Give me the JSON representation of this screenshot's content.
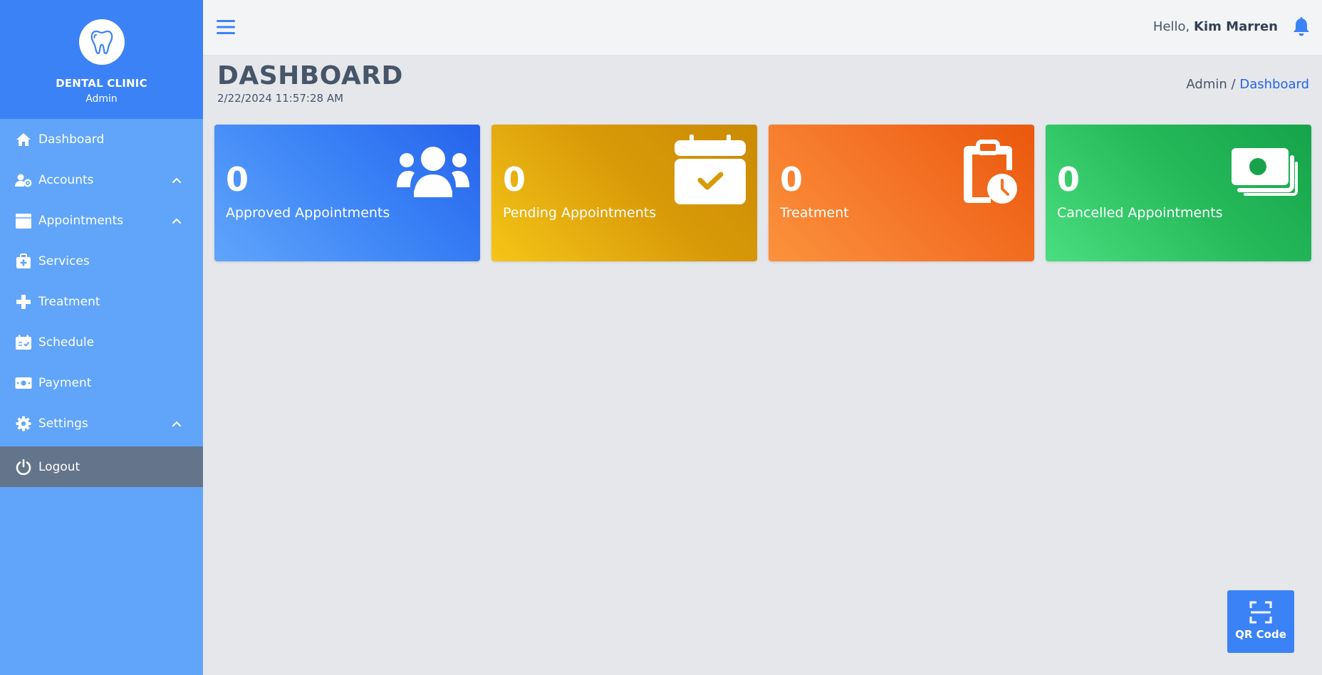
{
  "brand": {
    "name": "DENTAL CLINIC",
    "role": "Admin",
    "logo_icon": "tooth-icon"
  },
  "sidebar": {
    "items": [
      {
        "label": "Dashboard",
        "icon": "home-icon",
        "expandable": false
      },
      {
        "label": "Accounts",
        "icon": "user-gear-icon",
        "expandable": true
      },
      {
        "label": "Appointments",
        "icon": "calendar-icon",
        "expandable": true
      },
      {
        "label": "Services",
        "icon": "medkit-icon",
        "expandable": false
      },
      {
        "label": "Treatment",
        "icon": "medical-cross-icon",
        "expandable": false
      },
      {
        "label": "Schedule",
        "icon": "calendar-check-icon",
        "expandable": false
      },
      {
        "label": "Payment",
        "icon": "money-bill-icon",
        "expandable": false
      },
      {
        "label": "Settings",
        "icon": "gear-icon",
        "expandable": true
      }
    ],
    "logout": {
      "label": "Logout",
      "icon": "power-icon"
    }
  },
  "topbar": {
    "greeting_prefix": "Hello,",
    "user_name": "Kim Marren",
    "menu_icon": "hamburger-icon",
    "notification_icon": "bell-icon"
  },
  "page": {
    "title": "DASHBOARD",
    "datetime": "2/22/2024 11:57:28 AM",
    "breadcrumb": {
      "root": "Admin",
      "separator": "/",
      "current": "Dashboard"
    }
  },
  "cards": [
    {
      "count": "0",
      "label": "Approved Appointments",
      "icon": "users-icon",
      "color": "#3b82f6"
    },
    {
      "count": "0",
      "label": "Pending Appointments",
      "icon": "calendar-check-icon",
      "color": "#eab308"
    },
    {
      "count": "0",
      "label": "Treatment",
      "icon": "clipboard-clock-icon",
      "color": "#f97316"
    },
    {
      "count": "0",
      "label": "Cancelled Appointments",
      "icon": "money-bills-icon",
      "color": "#22c55e"
    }
  ],
  "qr_button": {
    "label": "QR Code",
    "icon": "qr-scan-icon"
  },
  "colors": {
    "sidebar": "#60a5fa",
    "brand_header": "#3b82f6",
    "logout_bg": "#64748b",
    "accent": "#2563eb",
    "background": "#e5e7eb"
  }
}
